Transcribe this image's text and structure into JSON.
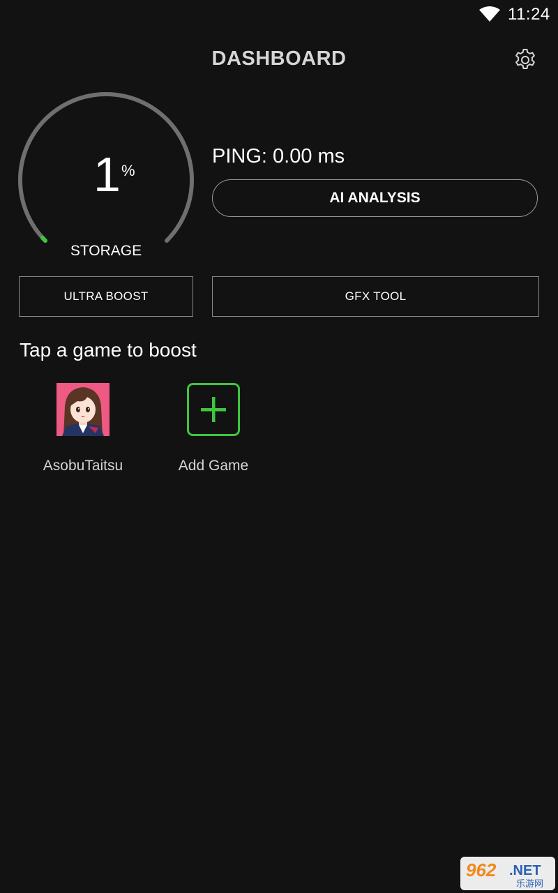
{
  "status_bar": {
    "time": "11:24"
  },
  "header": {
    "title": "DASHBOARD"
  },
  "gauge": {
    "value": "1",
    "unit": "%",
    "label": "STORAGE",
    "level_percent": 1
  },
  "ping": {
    "text": "PING: 0.00 ms"
  },
  "buttons": {
    "ai_analysis": "AI ANALYSIS",
    "ultra_boost": "ULTRA BOOST",
    "gfx_tool": "GFX TOOL"
  },
  "games": {
    "section_title": "Tap a game to boost",
    "items": [
      {
        "name": "AsobuTaitsu"
      },
      {
        "name": "Add Game"
      }
    ]
  },
  "watermark": {
    "text": "962.NET 乐游网"
  },
  "colors": {
    "background": "#121212",
    "accent_green": "#3ec63e",
    "gauge_track": "#6f6f6f",
    "game_icon_bg": "#ee5a83"
  }
}
